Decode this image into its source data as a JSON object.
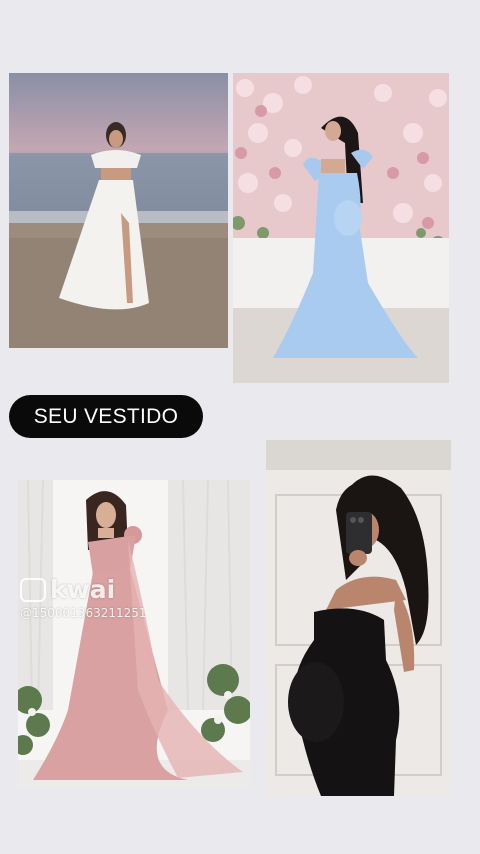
{
  "label": {
    "text": "SEU VESTIDO"
  },
  "watermark": {
    "brand": "kwai",
    "handle": "@150001363211251"
  },
  "photos": [
    {
      "name": "white-beach-dress-photo",
      "description": "white two-piece dress on beach"
    },
    {
      "name": "blue-tulle-maternity-photo",
      "description": "light blue tulle gown with flower wall"
    },
    {
      "name": "pink-one-shoulder-gown-photo",
      "description": "pink gown with cape and white curtains"
    },
    {
      "name": "black-bodycon-mirror-selfie-photo",
      "description": "black strapless maternity dress mirror selfie"
    }
  ],
  "colors": {
    "background": "#e9e9ee",
    "pill": "#0a0a0a",
    "pill_text": "#ffffff"
  }
}
